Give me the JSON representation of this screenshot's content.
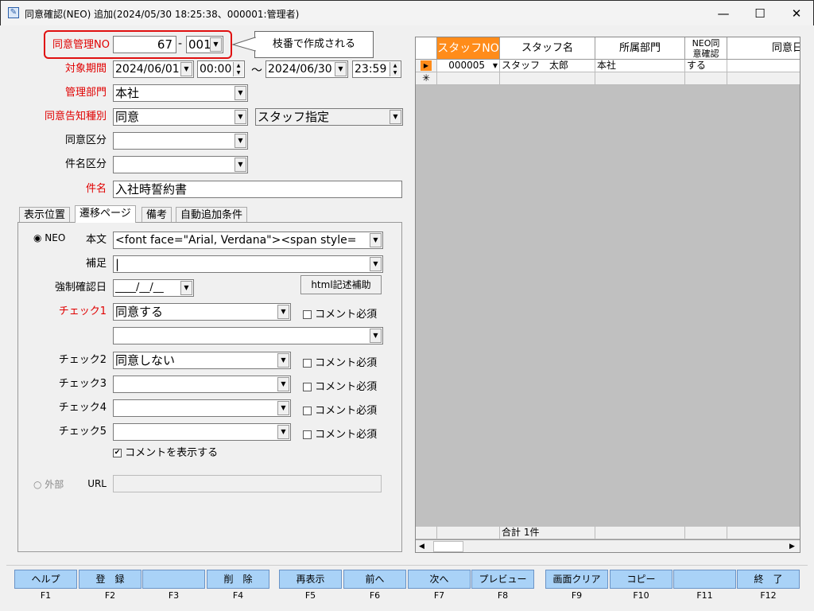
{
  "window": {
    "title": "同意確認(NEO)  追加(2024/05/30 18:25:38、000001:管理者)"
  },
  "form": {
    "no_label": "同意管理NO",
    "no_value": "67",
    "no_sep": "-",
    "branch_value": "001",
    "callout": "枝番で作成される",
    "period_label": "対象期間",
    "date_from": "2024/06/01",
    "time_from": "00:00",
    "tilde": "〜",
    "date_to": "2024/06/30",
    "time_to": "23:59",
    "dept_label": "管理部門",
    "dept_value": "本社",
    "notice_label": "同意告知種別",
    "notice_value": "同意",
    "notice_target": "スタッフ指定",
    "kubun_label": "同意区分",
    "kenmei_kubun_label": "件名区分",
    "title_label": "件名",
    "title_value": "入社時誓約書"
  },
  "tabs": [
    "表示位置",
    "遷移ページ",
    "備考",
    "自動追加条件"
  ],
  "page": {
    "neo_label": "NEO",
    "body_label": "本文",
    "body_value": "<font face=\"Arial, Verdana\"><span style=",
    "note_label": "補足",
    "force_label": "強制確認日",
    "force_value": "____/__/__",
    "html_btn": "html記述補助",
    "check1_label": "チェック1",
    "check1_value": "同意する",
    "check2_label": "チェック2",
    "check2_value": "同意しない",
    "check3_label": "チェック3",
    "check4_label": "チェック4",
    "check5_label": "チェック5",
    "comment_req": "コメント必須",
    "show_comment": "コメントを表示する",
    "external_label": "外部",
    "url_label": "URL"
  },
  "grid": {
    "headers": [
      "スタッフNO",
      "スタッフ名",
      "所属部門",
      "NEO同\n意確認",
      "同意日"
    ],
    "rows": [
      [
        "000005",
        "スタッフ　太郎",
        "本社",
        "する",
        ""
      ]
    ],
    "total": "合計 1件"
  },
  "fkeys": [
    {
      "label": "ヘルプ",
      "key": "F1"
    },
    {
      "label": "登　録",
      "key": "F2"
    },
    {
      "label": "",
      "key": "F3"
    },
    {
      "label": "削　除",
      "key": "F4"
    },
    {
      "label": "再表示",
      "key": "F5"
    },
    {
      "label": "前へ",
      "key": "F6"
    },
    {
      "label": "次へ",
      "key": "F7"
    },
    {
      "label": "プレビュー",
      "key": "F8"
    },
    {
      "label": "画面クリア",
      "key": "F9"
    },
    {
      "label": "コピー",
      "key": "F10"
    },
    {
      "label": "",
      "key": "F11"
    },
    {
      "label": "終　了",
      "key": "F12"
    }
  ]
}
